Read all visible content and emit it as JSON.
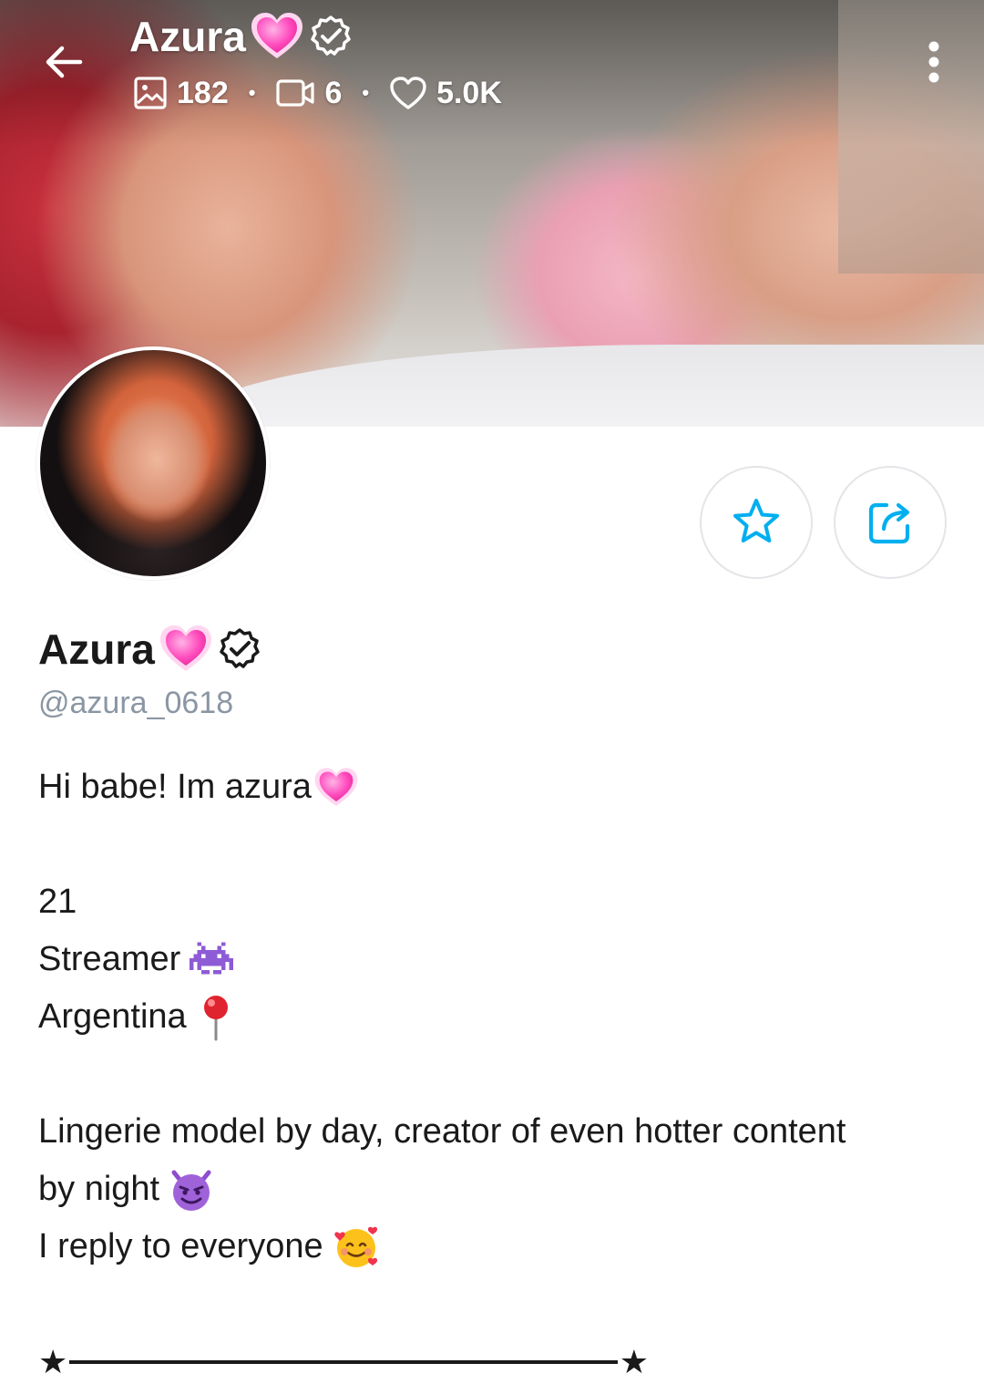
{
  "header": {
    "title": "Azura",
    "stats": {
      "photos": "182",
      "videos": "6",
      "likes": "5.0K"
    }
  },
  "profile": {
    "name": "Azura",
    "handle": "@azura_0618"
  },
  "bio": {
    "line1": "Hi babe! Im azura",
    "line2": "21",
    "line3": "Streamer",
    "line4": "Argentina",
    "line5": "Lingerie model by day, creator of even hotter content",
    "line6": "by night",
    "line7": "I reply to everyone"
  },
  "divider": {
    "star_left": "★",
    "star_right": "★"
  },
  "colors": {
    "accent": "#00aff0",
    "handle": "#8a96a3",
    "text": "#1a1a1a"
  },
  "icons": {
    "back": "arrow-left-icon",
    "menu": "more-vertical-icon",
    "verified": "verified-badge-icon",
    "heart_emoji": "pink-heart-emoji",
    "photos": "image-icon",
    "videos": "video-icon",
    "likes": "heart-outline-icon",
    "favorite": "star-icon",
    "share": "share-icon"
  }
}
